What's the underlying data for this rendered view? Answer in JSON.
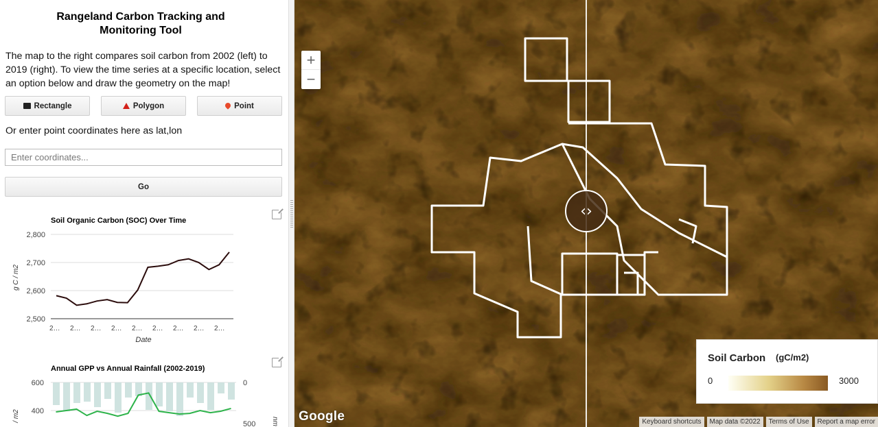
{
  "panel": {
    "title_line1": "Rangeland Carbon Tracking and",
    "title_line2": "Monitoring Tool",
    "description": "The map to the right compares soil carbon from 2002 (left) to 2019 (right). To view the time series at a specific location, select an option below and draw the geometry on the map!",
    "buttons": {
      "rectangle": "Rectangle",
      "polygon": "Polygon",
      "point": "Point"
    },
    "coord_label": "Or enter point coordinates here as lat,lon",
    "coord_placeholder": "Enter coordinates...",
    "go_label": "Go"
  },
  "chart_data": [
    {
      "type": "line",
      "title": "Soil Organic Carbon (SOC) Over Time",
      "xlabel": "Date",
      "ylabel": "g C / m2",
      "ylim": [
        2500,
        2800
      ],
      "yticks": [
        "2,800",
        "2,700",
        "2,600",
        "2,500"
      ],
      "xticks": [
        "2…",
        "2…",
        "2…",
        "2…",
        "2…",
        "2…",
        "2…",
        "2…",
        "2…"
      ],
      "series": [
        {
          "values": [
            2582,
            2573,
            2548,
            2553,
            2563,
            2568,
            2558,
            2557,
            2602,
            2683,
            2687,
            2692,
            2707,
            2713,
            2700,
            2675,
            2692,
            2737
          ]
        }
      ],
      "color": "#2b0c0c"
    },
    {
      "type": "bar",
      "title": "Annual GPP vs Annual Rainfall (2002-2019)",
      "yticks_left": [
        "600",
        "400"
      ],
      "yticks_right": [
        "0",
        "500"
      ],
      "ylabel_left_partial": "/ m2",
      "ylabel_right_partial": "nm",
      "series": [
        {
          "kind": "line",
          "values": [
            390,
            400,
            410,
            365,
            395,
            380,
            360,
            380,
            510,
            525,
            395,
            385,
            375,
            380,
            400,
            385,
            395,
            415
          ]
        }
      ],
      "bar_color": "#cfe3e0",
      "line_color": "#2db34a"
    }
  ],
  "map": {
    "legend": {
      "title": "Soil Carbon",
      "unit": "(gC/m2)",
      "min": "0",
      "max": "3000"
    },
    "google": "Google",
    "attribution": [
      "Keyboard shortcuts",
      "Map data ©2022",
      "Terms of Use",
      "Report a map error"
    ],
    "zoom_in": "+",
    "zoom_out": "−",
    "split_handle": "‹›"
  }
}
